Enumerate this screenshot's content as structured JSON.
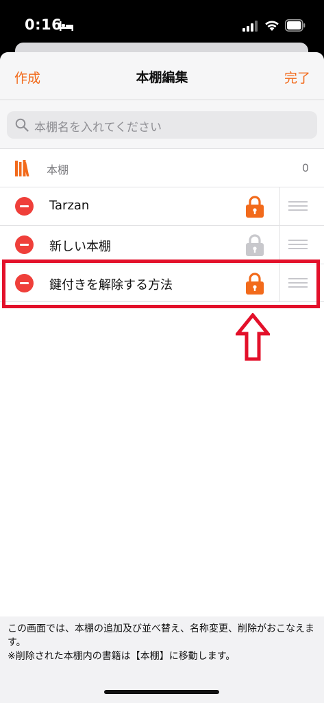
{
  "status_bar": {
    "time": "0:16"
  },
  "nav": {
    "left": "作成",
    "title": "本棚編集",
    "right": "完了"
  },
  "search": {
    "placeholder": "本棚名を入れてください"
  },
  "shelf_header": {
    "label": "本棚",
    "count": "0"
  },
  "rows": [
    {
      "label": "Tarzan",
      "locked": true
    },
    {
      "label": "新しい本棚",
      "locked": false
    },
    {
      "label": "鍵付きを解除する方法",
      "locked": true
    }
  ],
  "footer": {
    "line1": "この画面では、本棚の追加及び並べ替え、名称変更、削除がおこなえます。",
    "line2": "※削除された本棚内の書籍は【本棚】に移動します。"
  },
  "colors": {
    "accent": "#f26a1b",
    "delete": "#ef3f3a",
    "highlight": "#e3102a",
    "lock_off": "#c8c8cc"
  }
}
